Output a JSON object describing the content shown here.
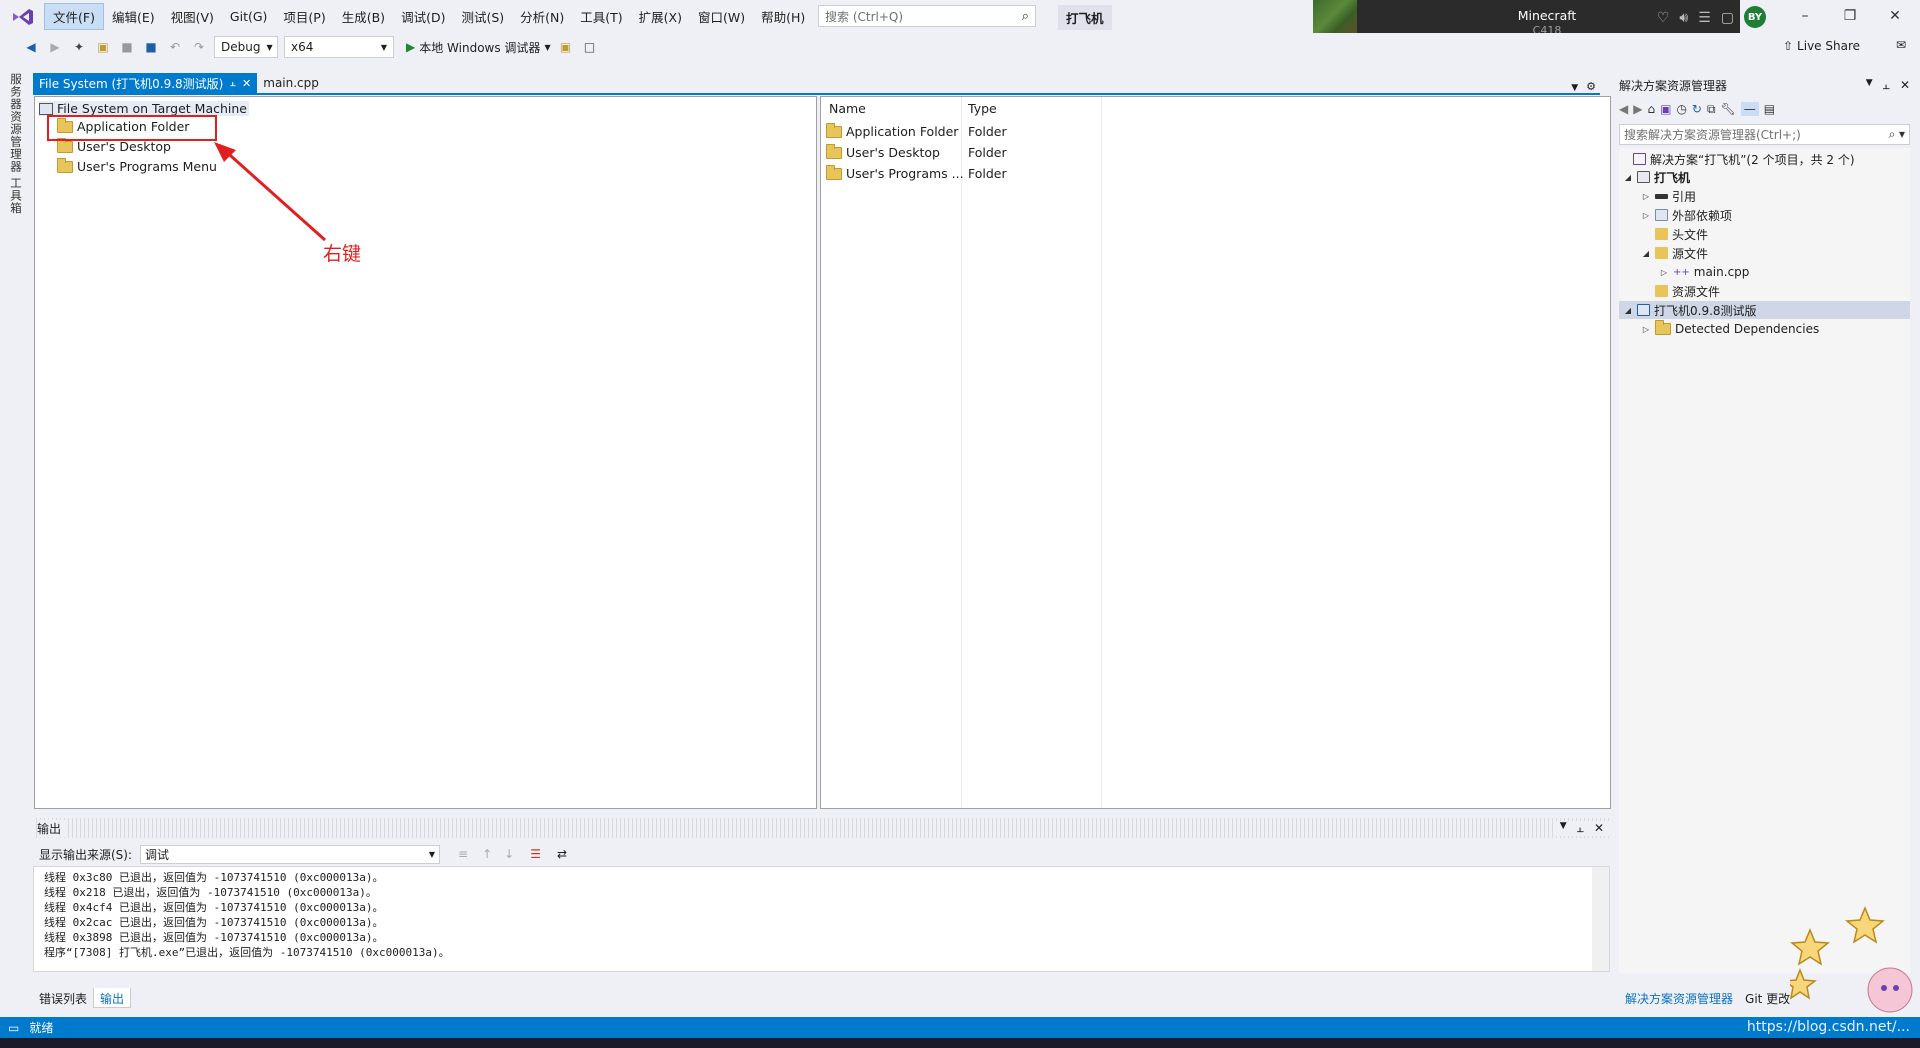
{
  "menubar": {
    "items": [
      "文件(F)",
      "编辑(E)",
      "视图(V)",
      "Git(G)",
      "项目(P)",
      "生成(B)",
      "调试(D)",
      "测试(S)",
      "分析(N)",
      "工具(T)",
      "扩展(X)",
      "窗口(W)",
      "帮助(H)"
    ],
    "search_placeholder": "搜索 (Ctrl+Q)",
    "project_name": "打飞机"
  },
  "media": {
    "title": "Minecraft",
    "subtitle": "C418"
  },
  "user": {
    "initials": "BY"
  },
  "toolbar": {
    "config": "Debug",
    "platform": "x64",
    "run_label": "本地 Windows 调试器",
    "live_share": "Live Share"
  },
  "left_strip": {
    "tab1": "服务器资源管理器",
    "tab2": "工具箱"
  },
  "doc_tabs": [
    {
      "label": "File System (打飞机0.9.8测试版)"
    },
    {
      "label": "main.cpp"
    }
  ],
  "fs_tree": {
    "root": "File System on Target Machine",
    "children": [
      "Application Folder",
      "User's Desktop",
      "User's Programs Menu"
    ]
  },
  "annotation": {
    "label": "右键",
    "color": "#e21f1f"
  },
  "fs_list": {
    "columns": [
      "Name",
      "Type"
    ],
    "rows": [
      {
        "name": "Application Folder",
        "type": "Folder"
      },
      {
        "name": "User's Desktop",
        "type": "Folder"
      },
      {
        "name": "User's Programs ...",
        "type": "Folder"
      }
    ]
  },
  "output": {
    "title": "输出",
    "source_label": "显示输出来源(S):",
    "source_value": "调试",
    "lines": [
      "线程 0x3c80 已退出，返回值为 -1073741510 (0xc000013a)。",
      "线程 0x218 已退出，返回值为 -1073741510 (0xc000013a)。",
      "线程 0x4cf4 已退出，返回值为 -1073741510 (0xc000013a)。",
      "线程 0x2cac 已退出，返回值为 -1073741510 (0xc000013a)。",
      "线程 0x3898 已退出，返回值为 -1073741510 (0xc000013a)。",
      "程序“[7308] 打飞机.exe”已退出，返回值为 -1073741510 (0xc000013a)。"
    ]
  },
  "bottom_tabs": [
    "错误列表",
    "输出"
  ],
  "solution": {
    "title": "解决方案资源管理器",
    "search_placeholder": "搜索解决方案资源管理器(Ctrl+;)",
    "root": "解决方案“打飞机”(2 个项目，共 2 个)",
    "project1": "打飞机",
    "items1": [
      "引用",
      "外部依赖项",
      "头文件",
      "源文件",
      "main.cpp",
      "资源文件"
    ],
    "project2": "打飞机0.9.8测试版",
    "items2": [
      "Detected Dependencies"
    ]
  },
  "sol_bottom_tabs": [
    "解决方案资源管理器",
    "Git 更改"
  ],
  "status": {
    "left": "就绪",
    "right": "https://blog.csdn.net/..."
  },
  "colors": {
    "accent": "#007acc",
    "annotation": "#e21f1f"
  }
}
